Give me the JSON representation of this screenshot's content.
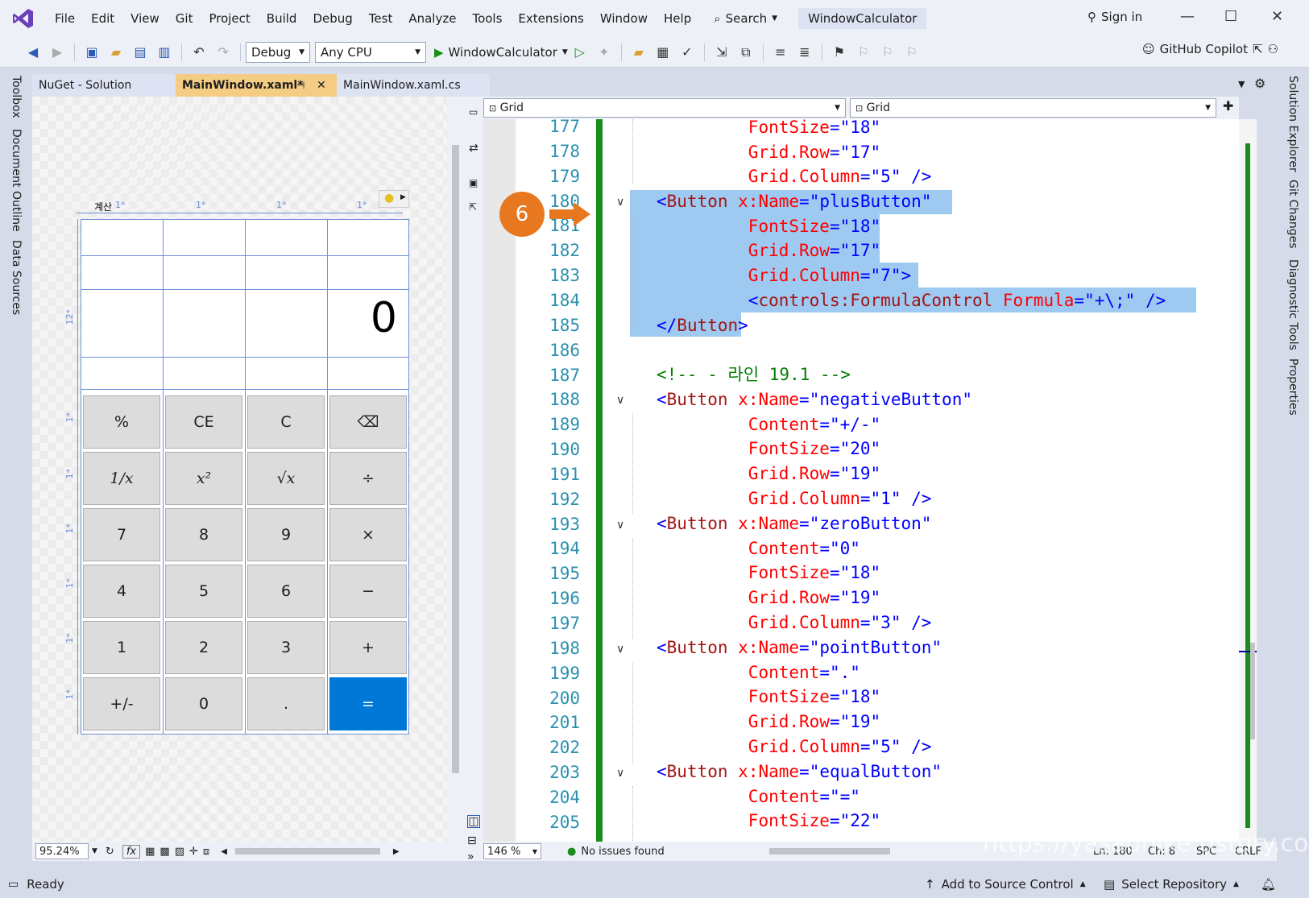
{
  "menubar": {
    "items": [
      "File",
      "Edit",
      "View",
      "Git",
      "Project",
      "Build",
      "Debug",
      "Test",
      "Analyze",
      "Tools",
      "Extensions",
      "Window",
      "Help"
    ],
    "search": "Search",
    "solution_name": "WindowCalculator",
    "sign_in": "Sign in"
  },
  "toolbar": {
    "config": "Debug",
    "platform": "Any CPU",
    "run_target": "WindowCalculator",
    "copilot": "GitHub Copilot"
  },
  "left_rail": [
    "Toolbox",
    "Document Outline",
    "Data Sources"
  ],
  "right_rail": [
    "Solution Explorer",
    "Git Changes",
    "Diagnostic Tools",
    "Properties"
  ],
  "tabs": [
    {
      "label": "NuGet - Solution",
      "active": false
    },
    {
      "label": "MainWindow.xaml*",
      "active": true
    },
    {
      "label": "MainWindow.xaml.cs",
      "active": false
    }
  ],
  "designer": {
    "title_snippet": "계산",
    "col_labels": [
      "1*",
      "1*",
      "1*",
      "1*"
    ],
    "row_labels": [
      "12*",
      "1*",
      "1*",
      "1*",
      "1*",
      "1*",
      "1*"
    ],
    "display_value": "0",
    "buttons": [
      [
        "%",
        "CE",
        "C",
        "⌫"
      ],
      [
        "1/x",
        "x²",
        "√x",
        "÷"
      ],
      [
        "7",
        "8",
        "9",
        "×"
      ],
      [
        "4",
        "5",
        "6",
        "−"
      ],
      [
        "1",
        "2",
        "3",
        "+"
      ],
      [
        "+/-",
        "0",
        ".",
        "="
      ]
    ],
    "zoom": "95.24%",
    "fx": "fx"
  },
  "editor": {
    "nav_left": "Grid",
    "nav_right": "Grid",
    "zoom": "146 %",
    "issues": "No issues found",
    "ln": "Ln: 180",
    "ch": "Ch: 8",
    "spc": "SPC",
    "crlf": "CRLF",
    "line_numbers": [
      "177",
      "178",
      "179",
      "180",
      "181",
      "182",
      "183",
      "184",
      "185",
      "186",
      "187",
      "188",
      "189",
      "190",
      "191",
      "192",
      "193",
      "194",
      "195",
      "196",
      "197",
      "198",
      "199",
      "200",
      "201",
      "202",
      "203",
      "204",
      "205"
    ]
  },
  "callout": "6",
  "status": {
    "ready": "Ready",
    "add_source": "Add to Source Control",
    "select_repo": "Select Repository"
  },
  "watermark": "https://yasadnike.tistory.com",
  "colors": {
    "accent": "#0078d7",
    "callout": "#e8781f",
    "selection": "#9ec9f0",
    "xml_tag": "#a31515",
    "xml_attr": "#ff0000",
    "xml_value": "#0000ff",
    "comment": "#008000"
  }
}
